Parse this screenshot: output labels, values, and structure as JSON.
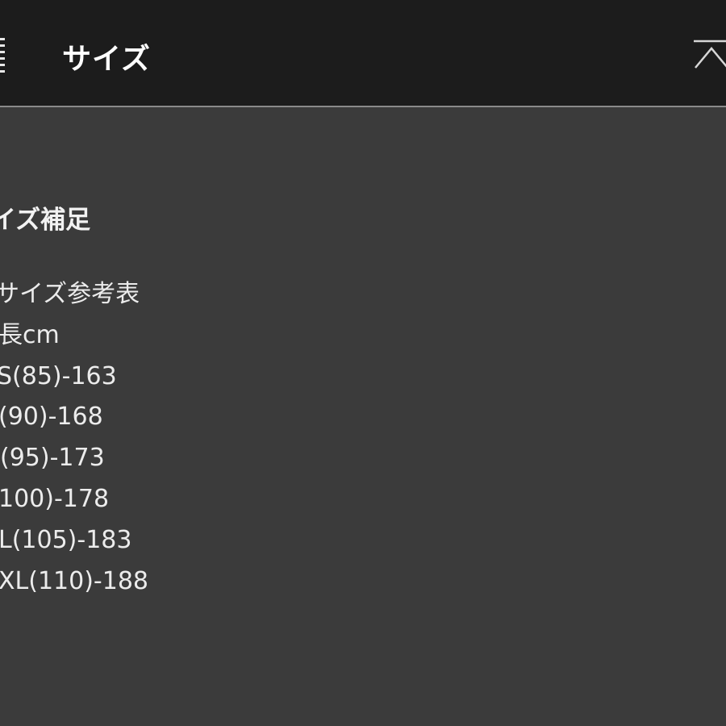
{
  "header": {
    "title": "サイズ",
    "menu_icon": "list-menu-icon",
    "collapse_icon": "chevron-up-icon"
  },
  "section": {
    "heading": "サイズ補足",
    "lines": [
      "サイズ参考表",
      "長cm",
      "S(85)-163",
      "(90)-168",
      "(95)-173",
      "100)-178",
      "L(105)-183",
      "XL(110)-188"
    ]
  },
  "colors": {
    "header_bg": "#1c1c1c",
    "body_bg": "#3b3b3b",
    "text": "#ececec",
    "divider": "#8a8a8a"
  }
}
